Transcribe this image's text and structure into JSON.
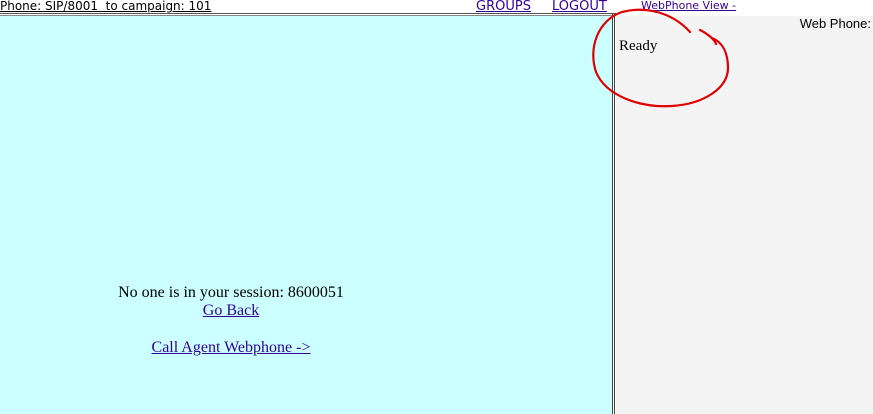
{
  "header": {
    "phone_info": "Phone: SIP/8001  to campaign: 101",
    "groups_label": "GROUPS",
    "logout_label": "LOGOUT",
    "webphone_view_label": "WebPhone View -"
  },
  "main": {
    "session_text": "No one is in your session: 8600051",
    "go_back_label": "Go Back",
    "call_webphone_label": "Call Agent Webphone ->"
  },
  "right_panel": {
    "web_phone_label": "Web Phone:",
    "status": "Ready"
  },
  "colors": {
    "main_bg": "#ccffff",
    "link": "#330099",
    "annotation": "#e00000",
    "right_bg": "#f4f4f4"
  }
}
